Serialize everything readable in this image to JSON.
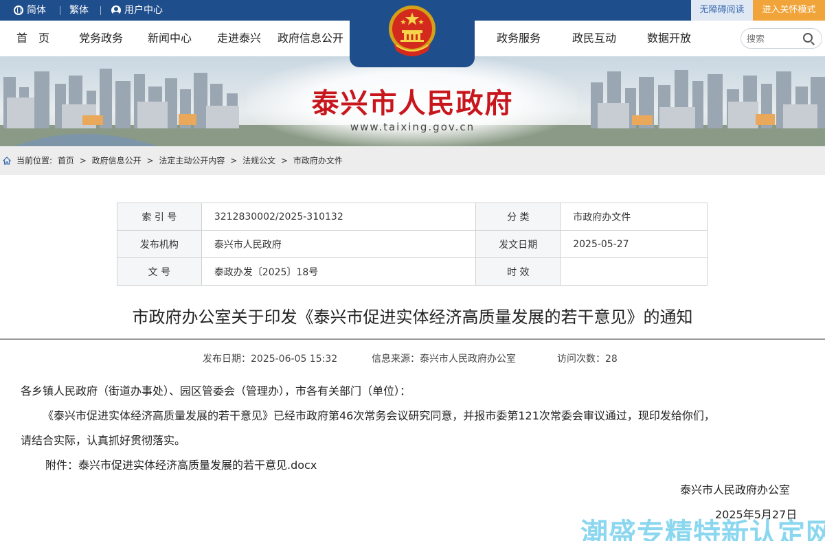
{
  "topbar": {
    "simplified": "简体",
    "traditional": "繁体",
    "user_center": "用户中心",
    "accessible": "无障碍阅读",
    "care_mode": "进入关怀模式"
  },
  "nav": {
    "items": [
      "首　页",
      "党务政务",
      "新闻中心",
      "走进泰兴",
      "政府信息公开",
      "政务服务",
      "政民互动",
      "数据开放"
    ],
    "search_placeholder": "搜索"
  },
  "banner": {
    "title": "泰兴市人民政府",
    "url": "www.taixing.gov.cn"
  },
  "breadcrumb": {
    "label": "当前位置:",
    "items": [
      "首页",
      "政府信息公开",
      "法定主动公开内容",
      "法规公文",
      "市政府办文件"
    ],
    "separator": ">"
  },
  "meta": {
    "index_label": "索 引 号",
    "index_value": "3212830002/2025-310132",
    "category_label": "分 类",
    "category_value": "市政府办文件",
    "publisher_label": "发布机构",
    "publisher_value": "泰兴市人民政府",
    "date_label": "发文日期",
    "date_value": "2025-05-27",
    "docno_label": "文 号",
    "docno_value": "泰政办发〔2025〕18号",
    "validity_label": "时 效",
    "validity_value": ""
  },
  "article": {
    "title": "市政府办公室关于印发《泰兴市促进实体经济高质量发展的若干意见》的通知",
    "publish_date": "发布日期：2025-06-05 15:32",
    "source": "信息来源：泰兴市人民政府办公室",
    "views": "访问次数：28",
    "salutation": "各乡镇人民政府（街道办事处）、园区管委会（管理办），市各有关部门（单位）：",
    "body_line1": "《泰兴市促进实体经济高质量发展的若干意见》已经市政府第46次常务会议研究同意，并报市委第121次常委会审议通过，现印发给你们，",
    "body_line2": "请结合实际，认真抓好贯彻落实。",
    "attachment_label": "附件：",
    "attachment_name": "泰兴市促进实体经济高质量发展的若干意见.docx",
    "signature": "泰兴市人民政府办公室",
    "sign_date": "2025年5月27日"
  },
  "watermark": "潮盛专精特新认定网",
  "colors": {
    "nav_blue": "#1f4e8c",
    "title_red": "#c8161d",
    "care_orange": "#f0a43a"
  }
}
